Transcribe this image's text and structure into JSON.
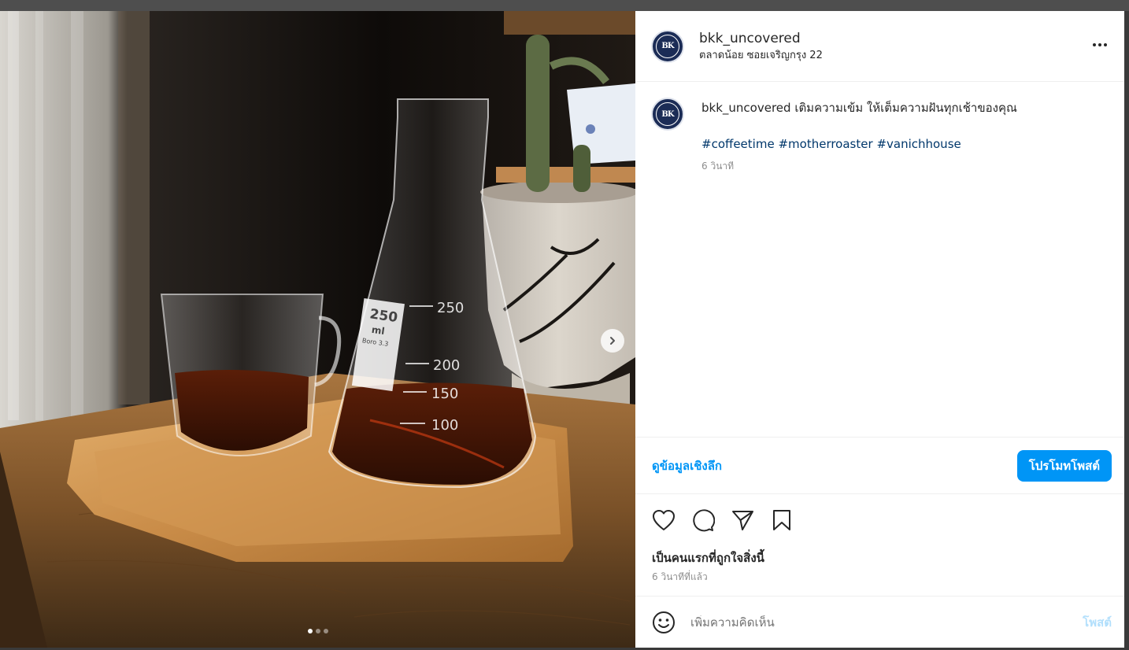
{
  "post": {
    "username": "bkk_uncovered",
    "location": "ตลาดน้อย ซอยเจริญกรุง 22",
    "avatar_monogram": "BK",
    "caption": {
      "username": "bkk_uncovered",
      "text": "เติมความเข้ม ให้เต็มความฝันทุกเช้าของคุณ",
      "hashtags": [
        "#coffeetime",
        "#motherroaster",
        "#vanichhouse"
      ],
      "time": "6 วินาที"
    }
  },
  "media": {
    "flask_volume": "250",
    "flask_unit": "ml",
    "flask_material": "Boro 3.3",
    "flask_marks": [
      "250",
      "200",
      "150",
      "100"
    ],
    "carousel_total": 3,
    "carousel_active": 1
  },
  "insights": {
    "link_label": "ดูข้อมูลเชิงลึก",
    "promote_label": "โปรโมทโพสต์"
  },
  "actions": {
    "icons": [
      "heart-icon",
      "comment-icon",
      "share-icon",
      "bookmark-icon"
    ]
  },
  "engagement": {
    "likes_text": "เป็นคนแรกที่ถูกใจสิ่งนี้",
    "time_ago": "6 วินาทีที่แล้ว"
  },
  "comment": {
    "placeholder": "เพิ่มความคิดเห็น",
    "post_label": "โพสต์"
  },
  "colors": {
    "accent": "#0095f6",
    "hashtag": "#00376b",
    "post_disabled": "#b2dffc",
    "avatar_bg": "#1b2c56"
  }
}
